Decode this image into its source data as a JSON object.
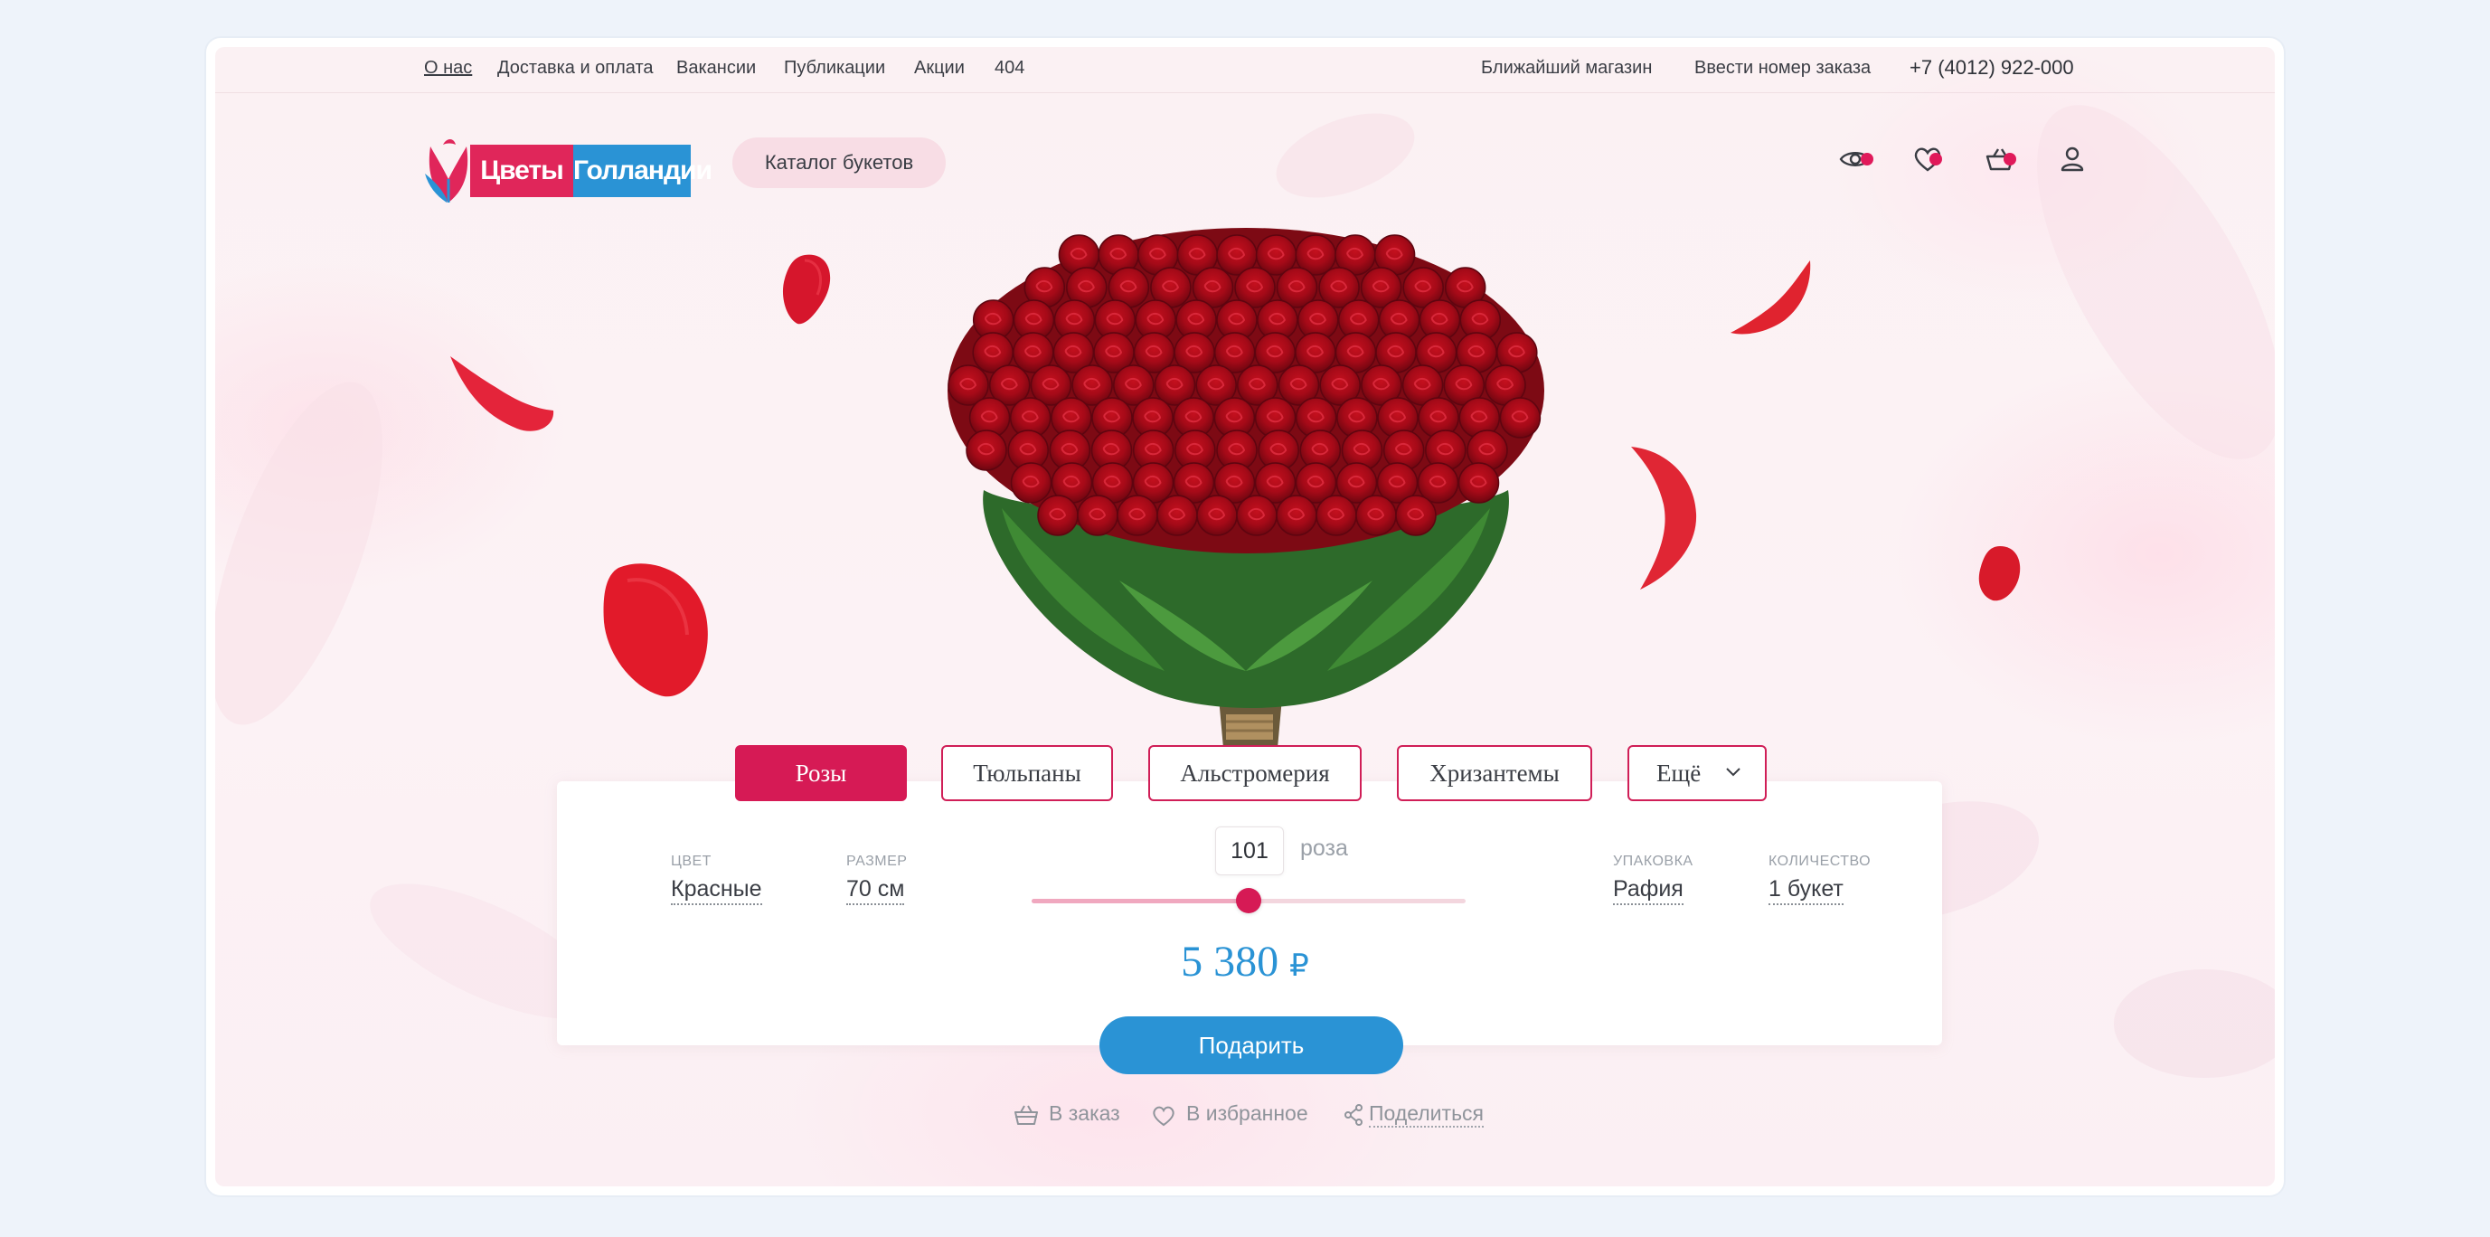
{
  "topnav": {
    "links": [
      "О нас",
      "Доставка и оплата",
      "Вакансии",
      "Публикации",
      "Акции",
      "404"
    ],
    "nearest_store": "Ближайший магазин",
    "enter_order": "Ввести номер заказа",
    "phone": "+7 (4012) 922-000"
  },
  "header": {
    "logo_word1": "Цветы",
    "logo_word2": "Голландии",
    "catalog_label": "Каталог букетов",
    "icons": [
      "eye-icon",
      "heart-icon",
      "basket-icon",
      "user-icon"
    ]
  },
  "tabs": [
    {
      "label": "Розы",
      "active": true
    },
    {
      "label": "Тюльпаны",
      "active": false
    },
    {
      "label": "Альстромерия",
      "active": false
    },
    {
      "label": "Хризантемы",
      "active": false
    },
    {
      "label": "Ещё",
      "active": false
    }
  ],
  "config": {
    "color": {
      "label": "ЦВЕТ",
      "value": "Красные"
    },
    "size": {
      "label": "РАЗМЕР",
      "value": "70 см"
    },
    "packing": {
      "label": "УПАКОВКА",
      "value": "Рафия"
    },
    "quantity": {
      "label": "КОЛИЧЕСТВО",
      "value": "1 букет"
    },
    "stems": "101",
    "stems_unit": "роза",
    "slider_fraction": 0.5
  },
  "price": {
    "amount": "5 380",
    "currency": "₽"
  },
  "actions": {
    "gift_label": "Подарить",
    "to_order": "В заказ",
    "to_favorites": "В избранное",
    "share": "Поделиться"
  },
  "colors": {
    "accent_red": "#d61a55",
    "accent_blue": "#2a93d5",
    "logo_red": "#e0265a",
    "logo_blue": "#2a93d5"
  }
}
